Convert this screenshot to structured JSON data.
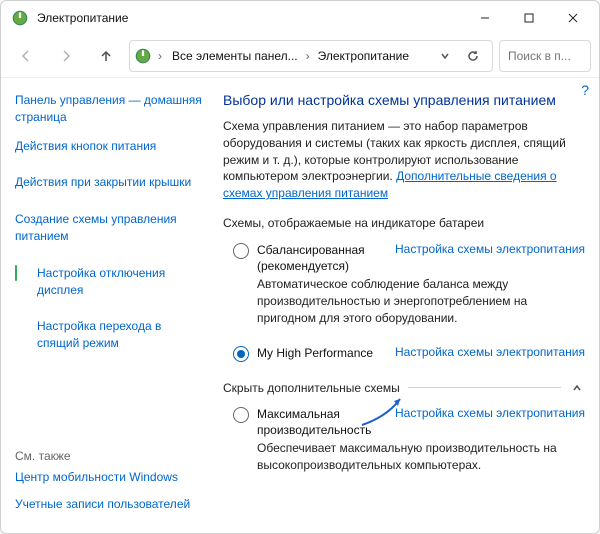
{
  "window": {
    "title": "Электропитание"
  },
  "nav": {
    "crumb1": "Все элементы панел...",
    "crumb2": "Электропитание",
    "search_placeholder": "Поиск в п..."
  },
  "sidebar": {
    "home": "Панель управления — домашняя страница",
    "items": [
      "Действия кнопок питания",
      "Действия при закрытии крышки",
      "Создание схемы управления питанием",
      "Настройка отключения дисплея",
      "Настройка перехода в спящий режим"
    ],
    "see_also_label": "См. также",
    "see_also": [
      "Центр мобильности Windows",
      "Учетные записи пользователей"
    ]
  },
  "main": {
    "heading": "Выбор или настройка схемы управления питанием",
    "description": "Схема управления питанием — это набор параметров оборудования и системы (таких как яркость дисплея, спящий режим и т. д.), которые контролируют использование компьютером электроэнергии.",
    "more_link": "Дополнительные сведения о схемах управления питанием",
    "battery_label": "Схемы, отображаемые на индикаторе батареи",
    "plans": [
      {
        "name": "Сбалансированная (рекомендуется)",
        "link": "Настройка схемы электропитания",
        "desc": "Автоматическое соблюдение баланса между производительностью и энергопотреблением на пригодном для этого оборудовании."
      },
      {
        "name": "My High Performance",
        "link": "Настройка схемы электропитания",
        "desc": ""
      }
    ],
    "hide_label": "Скрыть дополнительные схемы",
    "extra_plan": {
      "name": "Максимальная производительность",
      "link": "Настройка схемы электропитания",
      "desc": "Обеспечивает максимальную производительность на высокопроизводительных компьютерах."
    }
  }
}
